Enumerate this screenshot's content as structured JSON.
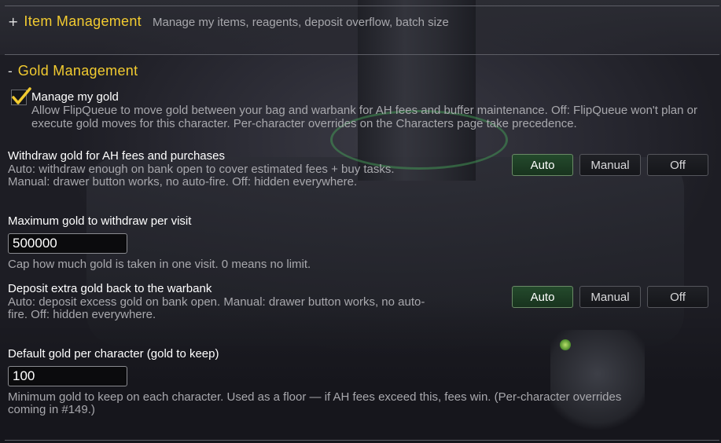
{
  "item_section": {
    "sign": "+",
    "title": "Item Management",
    "description": "Manage my items, reagents, deposit overflow, batch size"
  },
  "gold_section": {
    "sign": "-",
    "title": "Gold Management",
    "manage_gold": {
      "label": "Manage my gold",
      "checked": true,
      "description": "Allow FlipQueue to move gold between your bag and warbank for AH fees and buffer maintenance. Off: FlipQueue won't plan or execute gold moves for this character. Per-character overrides on the Characters page take precedence."
    },
    "withdraw": {
      "label": "Withdraw gold for AH fees and purchases",
      "description_line1": "Auto: withdraw enough on bank open to cover estimated fees + buy tasks.",
      "description_line2": "Manual: drawer button works, no auto-fire. Off: hidden everywhere.",
      "options": [
        "Auto",
        "Manual",
        "Off"
      ],
      "selected": "Auto"
    },
    "max_withdraw": {
      "label": "Maximum gold to withdraw per visit",
      "value": "500000",
      "description": "Cap how much gold is taken in one visit. 0 means no limit."
    },
    "deposit": {
      "label": "Deposit extra gold back to the warbank",
      "description_line1": "Auto: deposit excess gold on bank open. Manual: drawer button works, no auto-",
      "description_line2": "fire. Off: hidden everywhere.",
      "options": [
        "Auto",
        "Manual",
        "Off"
      ],
      "selected": "Auto"
    },
    "default_gold": {
      "label": "Default gold per character (gold to keep)",
      "value": "100",
      "description_line1": "Minimum gold to keep on each character. Used as a floor — if AH fees exceed this, fees win. (Per-character overrides",
      "description_line2": "coming in #149.)"
    }
  },
  "colors": {
    "header_gold": "#f2cb30",
    "active_green": "#244a2c",
    "muted_text": "#a8a8ad"
  }
}
